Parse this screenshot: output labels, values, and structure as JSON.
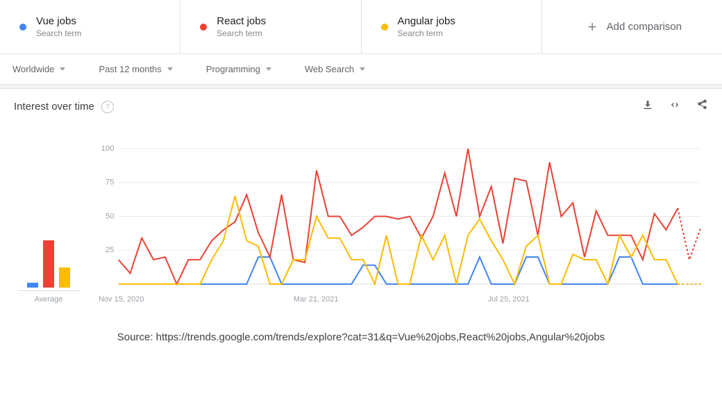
{
  "terms": [
    {
      "label": "Vue jobs",
      "subtitle": "Search term",
      "color": "#4285f4"
    },
    {
      "label": "React jobs",
      "subtitle": "Search term",
      "color": "#ea4335"
    },
    {
      "label": "Angular jobs",
      "subtitle": "Search term",
      "color": "#fbbc04"
    }
  ],
  "add_comparison": "Add comparison",
  "filters": {
    "region": "Worldwide",
    "time": "Past 12 months",
    "category": "Programming",
    "search_type": "Web Search"
  },
  "chart_title": "Interest over time",
  "average_label": "Average",
  "xticks": [
    "Nov 15, 2020",
    "Mar 21, 2021",
    "Jul 25, 2021"
  ],
  "source_text": "Source: https://trends.google.com/trends/explore?cat=31&q=Vue%20jobs,React%20jobs,Angular%20jobs",
  "chart_data": {
    "type": "line",
    "title": "Interest over time",
    "ylabel": "",
    "xlabel": "",
    "ylim": [
      0,
      100
    ],
    "yticks": [
      25,
      50,
      75,
      100
    ],
    "xrange": [
      "Nov 15, 2020",
      "Nov 7, 2021"
    ],
    "xticks": [
      "Nov 15, 2020",
      "Mar 21, 2021",
      "Jul 25, 2021"
    ],
    "averages": {
      "Vue jobs": 4,
      "React jobs": 40,
      "Angular jobs": 17
    },
    "series": [
      {
        "name": "Vue jobs",
        "color": "#4285f4",
        "values": [
          0,
          0,
          0,
          0,
          0,
          0,
          0,
          0,
          0,
          0,
          0,
          0,
          20,
          20,
          0,
          0,
          0,
          0,
          0,
          0,
          0,
          14,
          14,
          0,
          0,
          0,
          0,
          0,
          0,
          0,
          0,
          20,
          0,
          0,
          0,
          20,
          20,
          0,
          0,
          0,
          0,
          0,
          0,
          20,
          20,
          0,
          0,
          0,
          0,
          0,
          0
        ]
      },
      {
        "name": "React jobs",
        "color": "#ea4335",
        "values": [
          18,
          8,
          34,
          18,
          20,
          0,
          18,
          18,
          32,
          40,
          46,
          66,
          38,
          20,
          66,
          18,
          16,
          84,
          50,
          50,
          36,
          42,
          50,
          50,
          48,
          50,
          34,
          50,
          82,
          50,
          100,
          50,
          72,
          30,
          78,
          76,
          36,
          90,
          50,
          60,
          20,
          54,
          36,
          36,
          36,
          18,
          52,
          40,
          56,
          18,
          42
        ]
      },
      {
        "name": "Angular jobs",
        "color": "#fbbc04",
        "values": [
          0,
          0,
          0,
          0,
          0,
          0,
          0,
          0,
          18,
          32,
          65,
          32,
          28,
          0,
          0,
          18,
          18,
          50,
          34,
          34,
          18,
          18,
          0,
          36,
          0,
          0,
          36,
          18,
          36,
          0,
          36,
          48,
          32,
          18,
          0,
          28,
          36,
          0,
          0,
          22,
          18,
          18,
          0,
          36,
          20,
          36,
          18,
          18,
          0,
          0,
          0
        ]
      }
    ],
    "partial_end_points": 2
  }
}
